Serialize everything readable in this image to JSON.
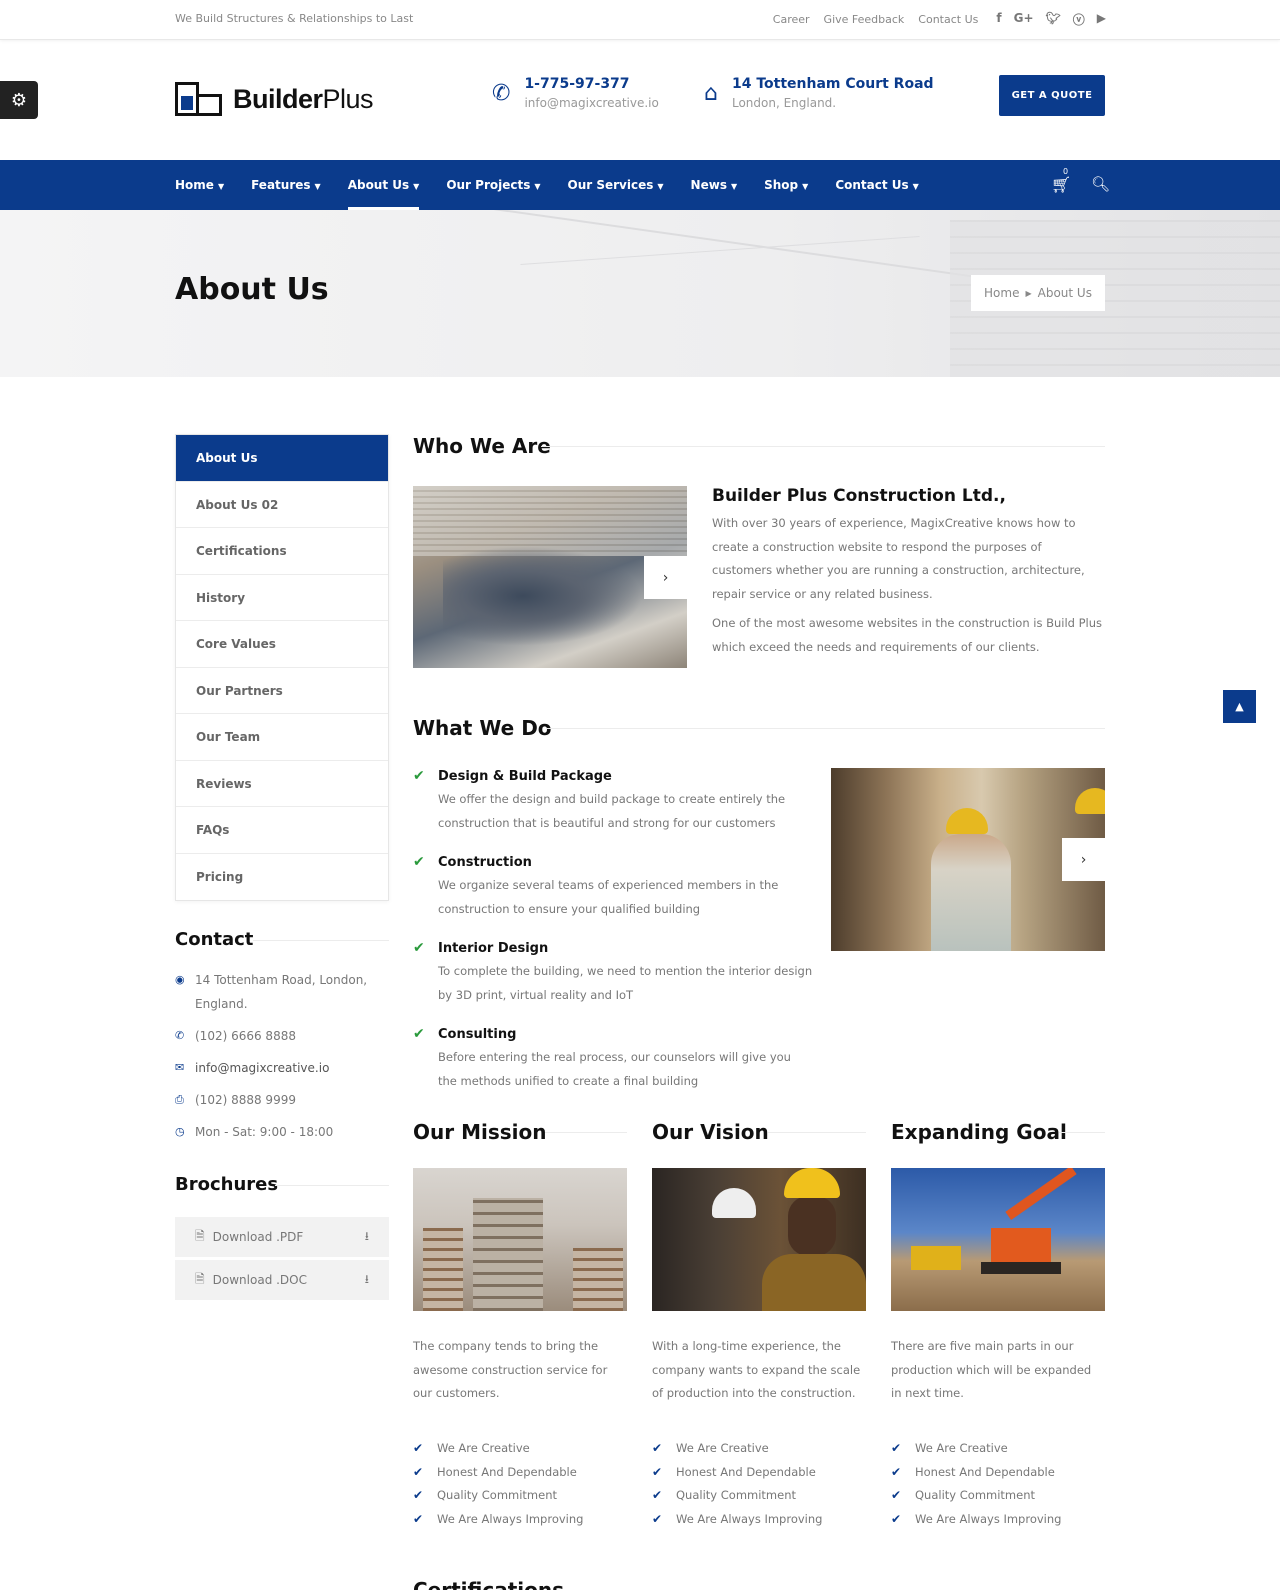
{
  "topbar": {
    "tagline": "We Build Structures & Relationships to Last",
    "links": [
      "Career",
      "Give Feedback",
      "Contact Us"
    ],
    "social_icons": [
      "facebook-icon",
      "google-plus-icon",
      "twitter-icon",
      "vimeo-icon",
      "youtube-icon"
    ]
  },
  "header": {
    "logo_bold": "Builder",
    "logo_light": "Plus",
    "phone": "1-775-97-377",
    "email": "info@magixcreative.io",
    "address_line1": "14 Tottenham Court Road",
    "address_line2": "London, England.",
    "quote_button": "GET A QUOTE"
  },
  "nav": {
    "items": [
      {
        "label": "Home"
      },
      {
        "label": "Features"
      },
      {
        "label": "About Us",
        "active": true
      },
      {
        "label": "Our Projects"
      },
      {
        "label": "Our Services"
      },
      {
        "label": "News"
      },
      {
        "label": "Shop"
      },
      {
        "label": "Contact Us"
      }
    ],
    "cart_count": "0"
  },
  "banner": {
    "title": "About Us",
    "breadcrumb": [
      "Home",
      "About Us"
    ]
  },
  "sidebar": {
    "menu": [
      "About Us",
      "About Us 02",
      "Certifications",
      "History",
      "Core Values",
      "Our Partners",
      "Our Team",
      "Reviews",
      "FAQs",
      "Pricing"
    ],
    "contact_title": "Contact",
    "contact": {
      "address": "14 Tottenham Road, London, England.",
      "phone": "(102) 6666 8888",
      "email": "info@magixcreative.io",
      "fax": "(102) 8888 9999",
      "hours": "Mon - Sat: 9:00 - 18:00"
    },
    "brochures_title": "Brochures",
    "brochures": [
      "Download .PDF",
      "Download .DOC"
    ]
  },
  "who": {
    "title": "Who We Are",
    "company": "Builder Plus Construction Ltd.,",
    "p1": "With over 30 years of experience, MagixCreative knows how to create a construction website to respond the purposes of customers whether you are running a construction, architecture, repair service or any related business.",
    "p2": "One of the most awesome websites in the construction is Build Plus which exceed the needs and requirements of our clients."
  },
  "what": {
    "title": "What We Do",
    "services": [
      {
        "title": "Design & Build Package",
        "desc": "We offer the design and build package to create entirely the construction that is beautiful and strong for our customers"
      },
      {
        "title": "Construction",
        "desc": "We organize several teams of experienced members in the construction to ensure your qualified building"
      },
      {
        "title": "Interior Design",
        "desc": "To complete the building, we need to mention the interior design by 3D print, virtual reality and IoT"
      },
      {
        "title": "Consulting",
        "desc": "Before entering the real process, our counselors will give you the methods unified to create a final building"
      }
    ]
  },
  "columns": [
    {
      "title": "Our Mission",
      "desc": "The company tends to bring the awesome construction service for our customers.",
      "points": [
        "We Are Creative",
        "Honest And Dependable",
        "Quality Commitment",
        "We Are Always Improving"
      ]
    },
    {
      "title": "Our Vision",
      "desc": "With a long-time experience, the company wants to expand the scale of production into the construction.",
      "points": [
        "We Are Creative",
        "Honest And Dependable",
        "Quality Commitment",
        "We Are Always Improving"
      ]
    },
    {
      "title": "Expanding Goal",
      "desc": "There are five main parts in our production which will be expanded in next time.",
      "points": [
        "We Are Creative",
        "Honest And Dependable",
        "Quality Commitment",
        "We Are Always Improving"
      ]
    }
  ],
  "certifications_title": "Certifications",
  "colors": {
    "primary": "#0b3b8c",
    "check_green": "#2a9a3c"
  }
}
